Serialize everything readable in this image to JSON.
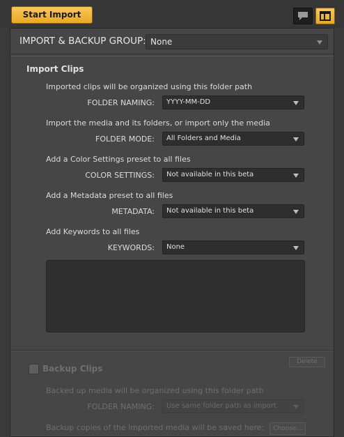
{
  "toolbar": {
    "start_import_label": "Start Import",
    "comment_view_icon": "speech-bubble-icon",
    "layout_view_icon": "panel-layout-icon",
    "accent_color": "#f0b63a"
  },
  "import_group": {
    "label": "IMPORT & BACKUP GROUP:",
    "value": "None"
  },
  "import_clips": {
    "title": "Import Clips",
    "folder_naming": {
      "description": "Imported clips will be organized using this folder path",
      "label": "FOLDER NAMING:",
      "value": "YYYY-MM-DD"
    },
    "folder_mode": {
      "description": "Import the media and its folders, or import only the media",
      "label": "FOLDER MODE:",
      "value": "All Folders and Media"
    },
    "color_settings": {
      "description": "Add a Color Settings preset to all files",
      "label": "COLOR SETTINGS:",
      "value": "Not available in this beta"
    },
    "metadata": {
      "description": "Add a Metadata preset to all files",
      "label": "METADATA:",
      "value": "Not available in this beta"
    },
    "keywords": {
      "description": "Add Keywords to all files",
      "label": "KEYWORDS:",
      "value": "None"
    }
  },
  "backup_clips": {
    "delete_label": "Delete",
    "title": "Backup Clips",
    "folder_naming": {
      "description": "Backed up media will be organized using this folder path",
      "label": "FOLDER NAMING:",
      "value": "Use same folder path as import"
    },
    "location_description": "Backup copies of the imported media will be saved here:",
    "choose_label": "Choose..."
  }
}
